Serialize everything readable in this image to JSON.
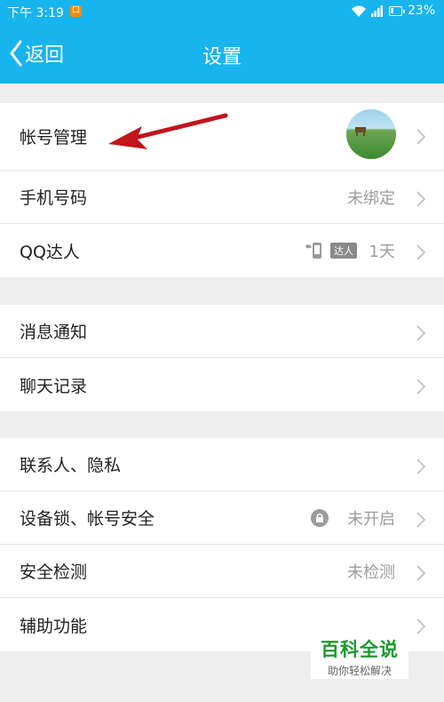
{
  "status": {
    "time": "下午 3:19",
    "notif_glyph": "口",
    "battery": "23%",
    "battery_level": 0.23
  },
  "header": {
    "back_label": "返回",
    "title": "设置"
  },
  "groups": [
    [
      {
        "label": "帐号管理",
        "value": "",
        "accessory": "avatar"
      },
      {
        "label": "手机号码",
        "value": "未绑定",
        "accessory": ""
      },
      {
        "label": "QQ达人",
        "value": "1天",
        "accessory": "badge",
        "badge_text": "达人"
      }
    ],
    [
      {
        "label": "消息通知",
        "value": ""
      },
      {
        "label": "聊天记录",
        "value": ""
      }
    ],
    [
      {
        "label": "联系人、隐私",
        "value": ""
      },
      {
        "label": "设备锁、帐号安全",
        "value": "未开启",
        "accessory": "lock"
      },
      {
        "label": "安全检测",
        "value": "未检测"
      },
      {
        "label": "辅助功能",
        "value": ""
      }
    ]
  ],
  "watermark": {
    "title": "百科全说",
    "subtitle": "助你轻松解决"
  },
  "colors": {
    "header": "#17b4ee",
    "annotation_arrow": "#c0151b",
    "background": "#eeeeef"
  }
}
